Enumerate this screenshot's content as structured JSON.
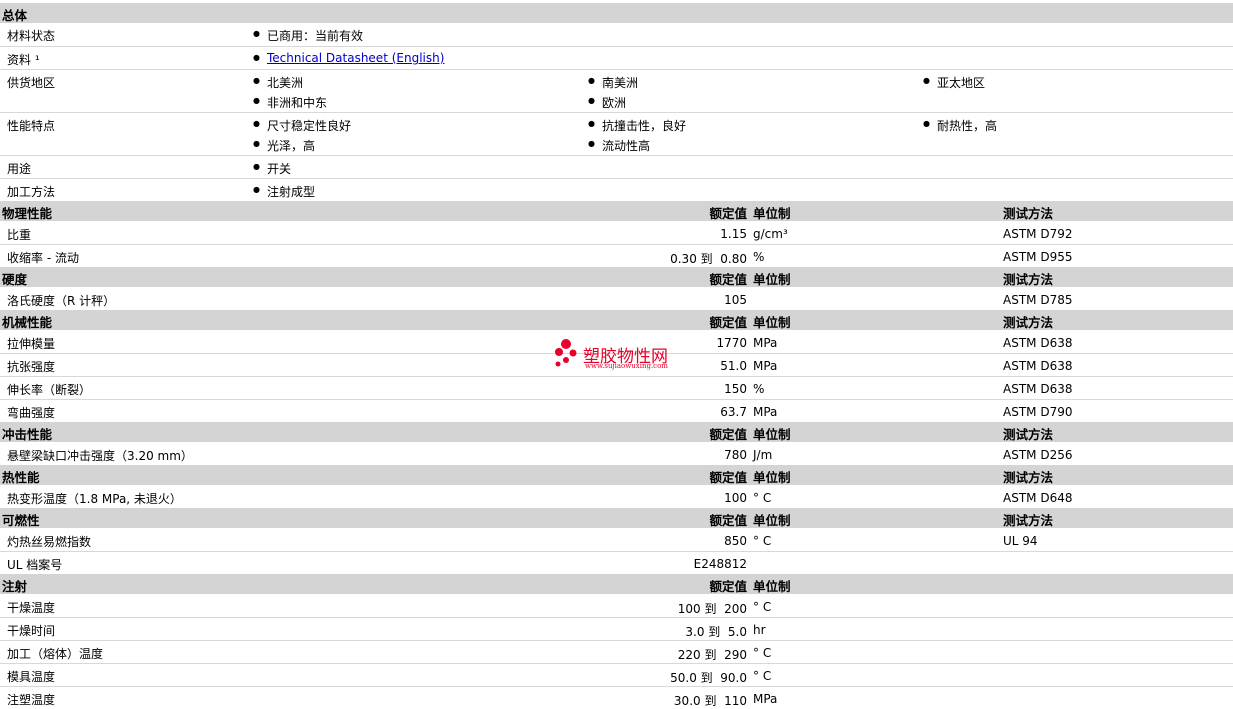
{
  "general": {
    "title": "总体",
    "status_label": "材料状态",
    "status_value": "已商用：当前有效",
    "docs_label": "资料 ¹",
    "docs_link": "Technical Datasheet (English)",
    "supply_label": "供货地区",
    "supply": [
      "北美洲",
      "南美洲",
      "亚太地区",
      "非洲和中东",
      "欧洲"
    ],
    "features_label": "性能特点",
    "features": [
      "尺寸稳定性良好",
      "抗撞击性，良好",
      "耐热性，高",
      "光泽，高",
      "流动性高"
    ],
    "use_label": "用途",
    "use_value": "开关",
    "process_label": "加工方法",
    "process_value": "注射成型"
  },
  "headers": {
    "value": "额定值",
    "unit": "单位制",
    "method": "测试方法"
  },
  "physical": {
    "title": "物理性能",
    "rows": [
      {
        "label": "比重",
        "value": "1.15",
        "unit": "g/cm³",
        "method": "ASTM D792"
      },
      {
        "label": "收缩率 - 流动",
        "value": "0.30 到  0.80",
        "unit": "%",
        "method": "ASTM D955"
      }
    ]
  },
  "hardness": {
    "title": "硬度",
    "rows": [
      {
        "label": "洛氏硬度（R 计秤）",
        "value": "105",
        "unit": "",
        "method": "ASTM D785"
      }
    ]
  },
  "mechanical": {
    "title": "机械性能",
    "rows": [
      {
        "label": "拉伸模量",
        "value": "1770",
        "unit": "MPa",
        "method": "ASTM D638"
      },
      {
        "label": "抗张强度",
        "value": "51.0",
        "unit": "MPa",
        "method": "ASTM D638"
      },
      {
        "label": "伸长率（断裂）",
        "value": "150",
        "unit": "%",
        "method": "ASTM D638"
      },
      {
        "label": "弯曲强度",
        "value": "63.7",
        "unit": "MPa",
        "method": "ASTM D790"
      }
    ]
  },
  "impact": {
    "title": "冲击性能",
    "rows": [
      {
        "label": "悬壁梁缺口冲击强度（3.20 mm）",
        "value": "780",
        "unit": "J/m",
        "method": "ASTM D256"
      }
    ]
  },
  "thermal": {
    "title": "热性能",
    "rows": [
      {
        "label": "热变形温度（1.8 MPa, 未退火）",
        "value": "100",
        "unit": "° C",
        "method": "ASTM D648"
      }
    ]
  },
  "flammability": {
    "title": "可燃性",
    "rows": [
      {
        "label": "灼热丝易燃指数",
        "value": "850",
        "unit": "° C",
        "method": "UL 94"
      },
      {
        "label": "UL 档案号",
        "value": "E248812",
        "unit": "",
        "method": ""
      }
    ]
  },
  "injection": {
    "title": "注射",
    "rows": [
      {
        "label": "干燥温度",
        "value": "100 到  200",
        "unit": "° C",
        "method": ""
      },
      {
        "label": "干燥时间",
        "value": "3.0 到  5.0",
        "unit": "hr",
        "method": ""
      },
      {
        "label": "加工（熔体）温度",
        "value": "220 到  290",
        "unit": "° C",
        "method": ""
      },
      {
        "label": "模具温度",
        "value": "50.0 到  90.0",
        "unit": "° C",
        "method": ""
      },
      {
        "label": "注塑温度",
        "value": "30.0 到  110",
        "unit": "MPa",
        "method": ""
      }
    ]
  },
  "watermark": {
    "text": "塑胶物性网",
    "url": "www.sujiaowuxing.com",
    "color": "#e8002a"
  }
}
